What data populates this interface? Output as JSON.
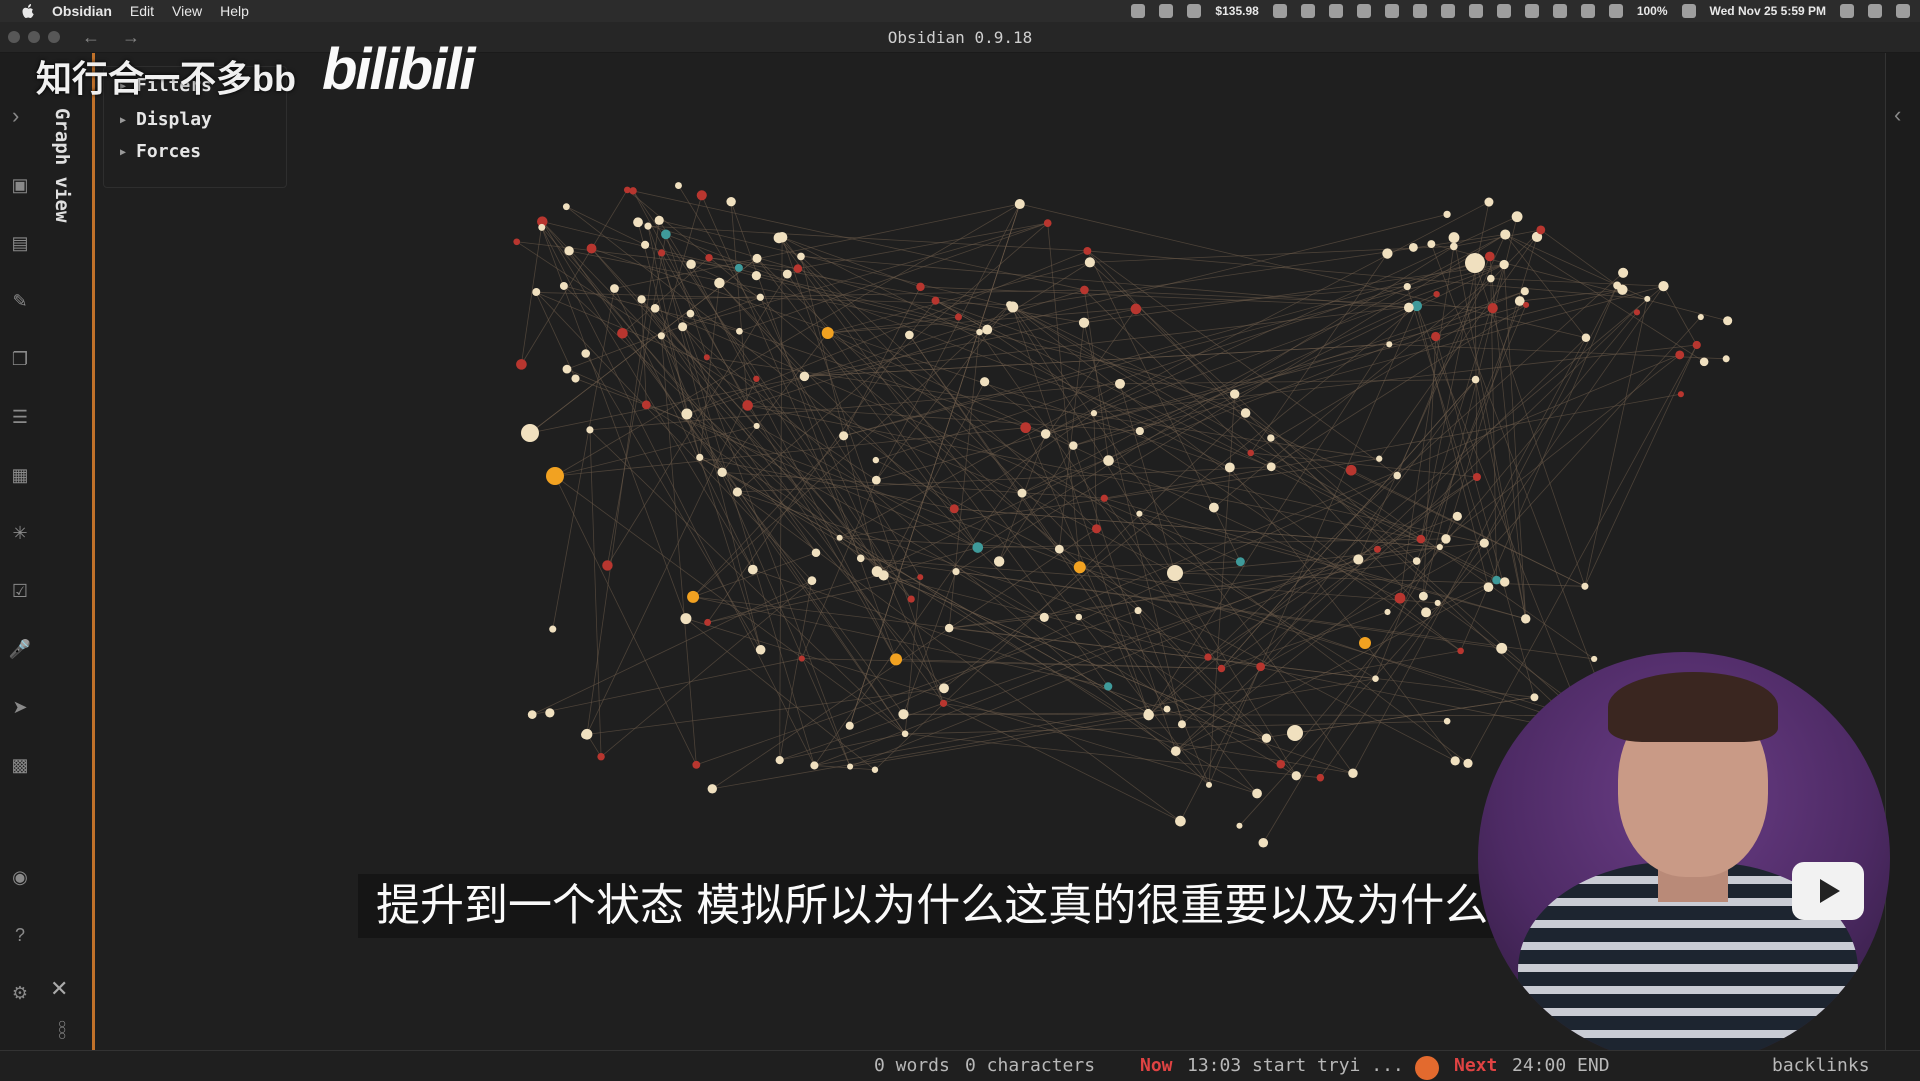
{
  "menubar": {
    "app": "Obsidian",
    "items": [
      "Edit",
      "View",
      "Help"
    ],
    "stocks": "$135.98",
    "battery": "100%",
    "datetime": "Wed Nov 25  5:59 PM"
  },
  "window": {
    "title": "Obsidian 0.9.18"
  },
  "sidebar": {
    "tab_label": "Graph view"
  },
  "graph_panel": {
    "items": [
      "Filters",
      "Display",
      "Forces"
    ]
  },
  "watermark": {
    "text": "知行合一不多bb",
    "logo": "bilibili"
  },
  "subtitle": "提升到一个状态 模拟所以为什么这真的很重要以及为什么",
  "statusbar": {
    "words": "0 words",
    "chars": "0 characters",
    "now_label": "Now",
    "now_text": "13:03 start tryi ...",
    "next_label": "Next",
    "next_text": "24:00 END",
    "backlinks": "backlinks"
  },
  "colors": {
    "accent": "#c0712a",
    "node": "#f0e0bf",
    "node_red": "#b8362f",
    "node_teal": "#3f9a9a",
    "node_orange": "#f2a221",
    "edge": "#6b5a4a"
  },
  "icons": [
    "apple-icon",
    "graph-icon",
    "table-icon",
    "pencil-icon",
    "copy-icon",
    "menu-icon",
    "template-icon",
    "network-icon",
    "calendar-icon",
    "mic-icon",
    "send-icon",
    "layout-icon",
    "camera-icon",
    "help-icon",
    "settings-icon"
  ]
}
